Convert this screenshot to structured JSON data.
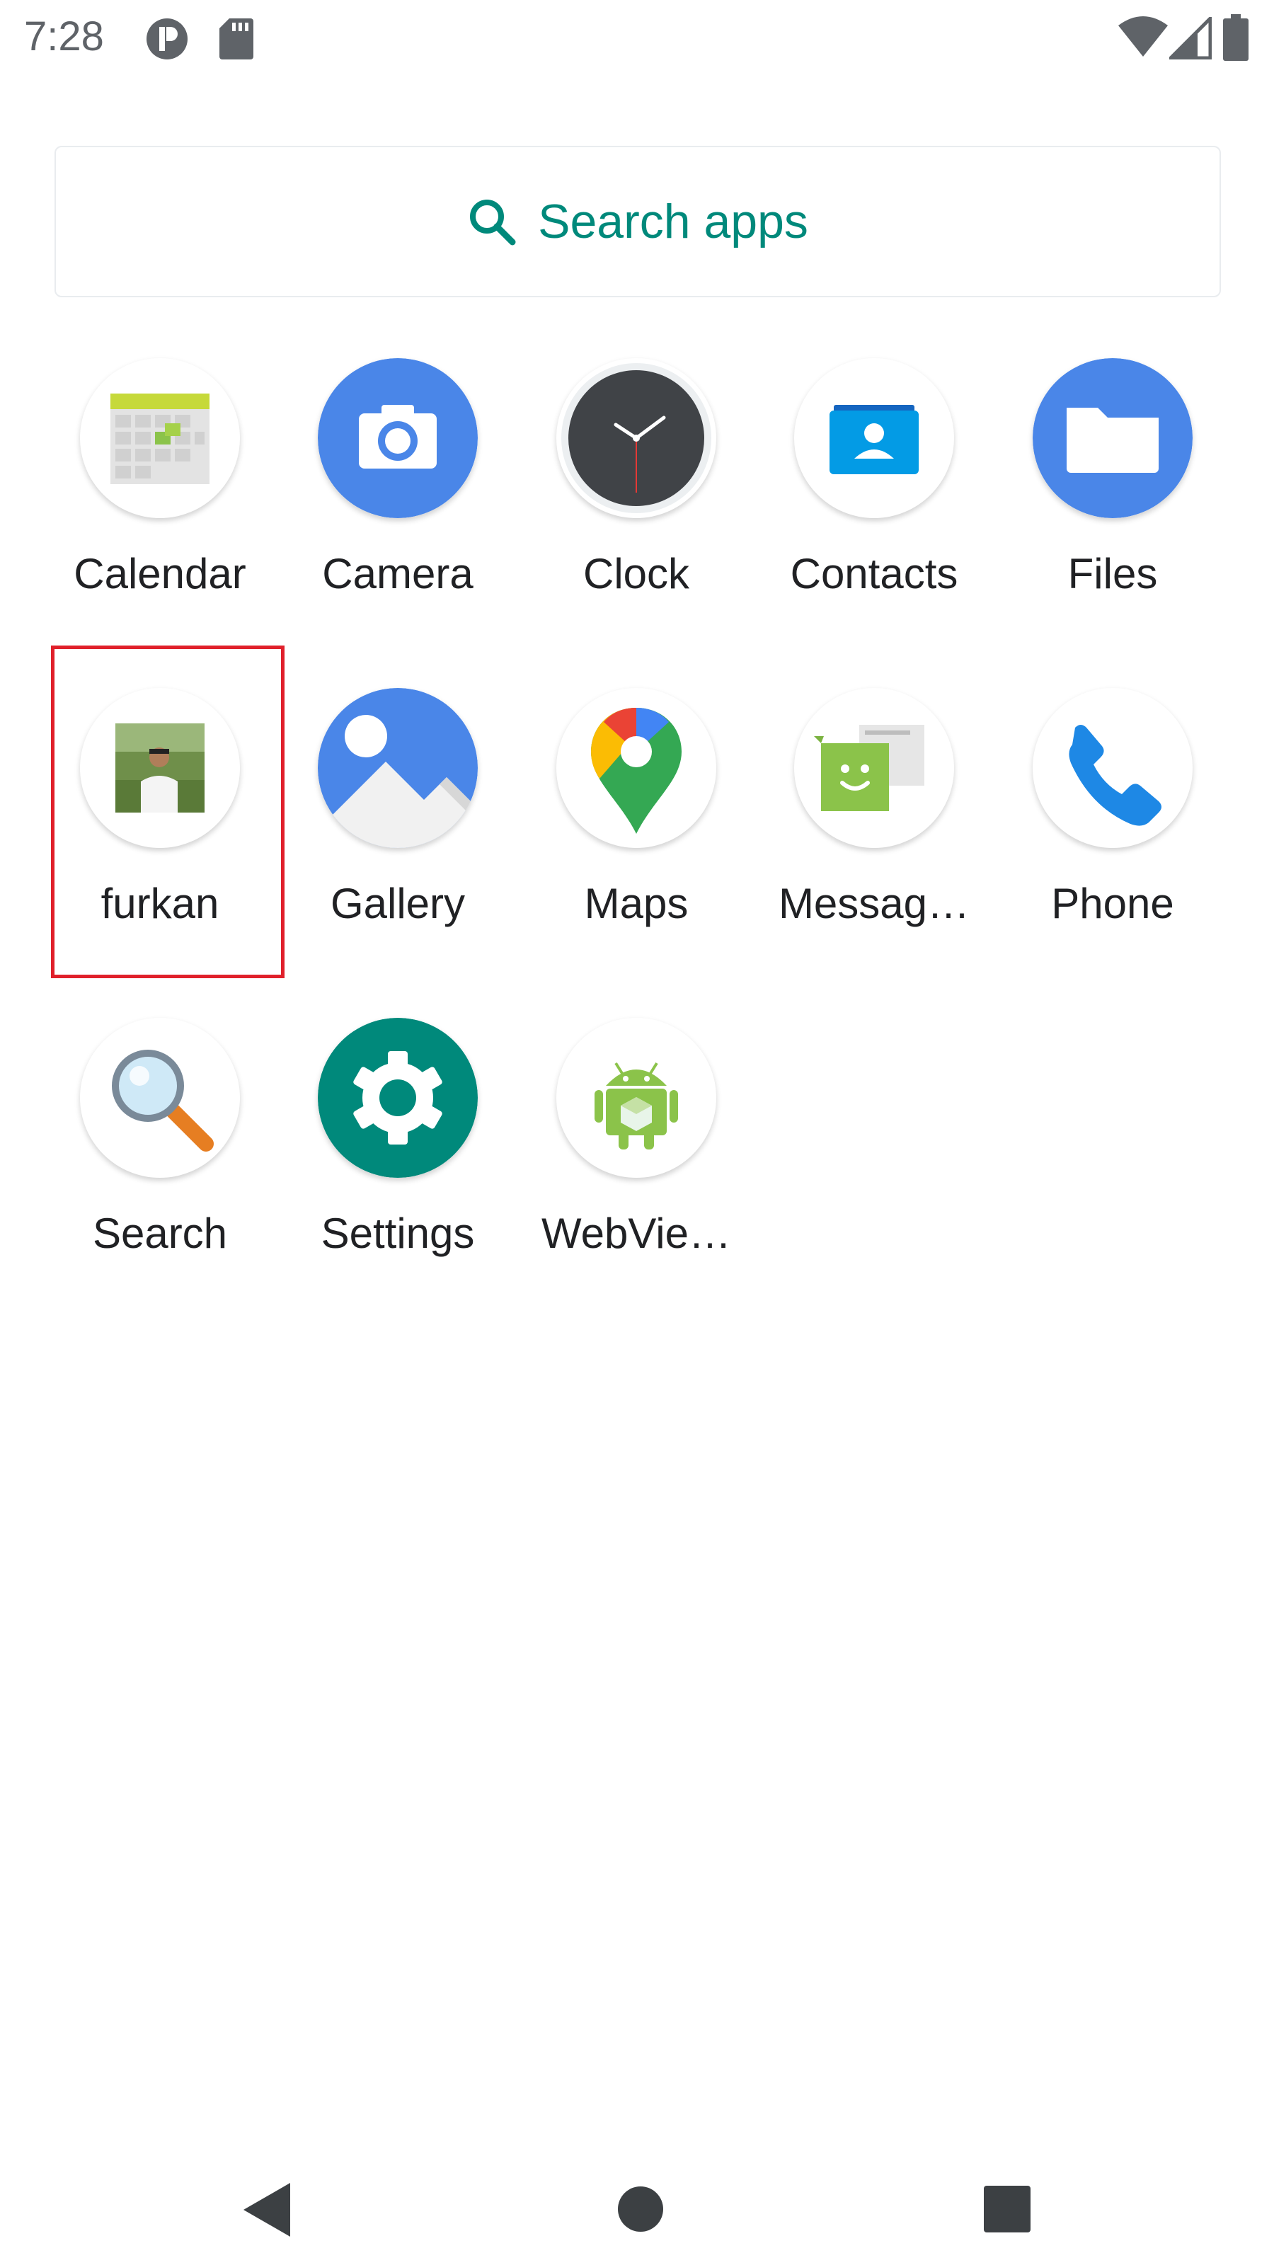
{
  "status_bar": {
    "time": "7:28",
    "icons": [
      "profile-badge-icon",
      "sd-card-icon",
      "wifi-icon",
      "cellular-signal-icon",
      "battery-icon"
    ]
  },
  "search": {
    "label": "Search apps",
    "icon": "search-icon",
    "color": "#00897b"
  },
  "apps": [
    {
      "label": "Calendar",
      "icon": "calendar-icon"
    },
    {
      "label": "Camera",
      "icon": "camera-icon"
    },
    {
      "label": "Clock",
      "icon": "clock-icon"
    },
    {
      "label": "Contacts",
      "icon": "contacts-icon"
    },
    {
      "label": "Files",
      "icon": "files-icon"
    },
    {
      "label": "furkan",
      "icon": "furkan-photo-icon",
      "highlighted": true
    },
    {
      "label": "Gallery",
      "icon": "gallery-icon"
    },
    {
      "label": "Maps",
      "icon": "maps-icon"
    },
    {
      "label": "Messag…",
      "icon": "messages-icon"
    },
    {
      "label": "Phone",
      "icon": "phone-icon"
    },
    {
      "label": "Search",
      "icon": "magnifier-icon"
    },
    {
      "label": "Settings",
      "icon": "settings-gear-icon"
    },
    {
      "label": "WebVie…",
      "icon": "android-webview-icon"
    }
  ],
  "highlight_color": "#e0202b",
  "nav_bar": {
    "buttons": [
      "back-icon",
      "home-icon",
      "recents-icon"
    ]
  }
}
